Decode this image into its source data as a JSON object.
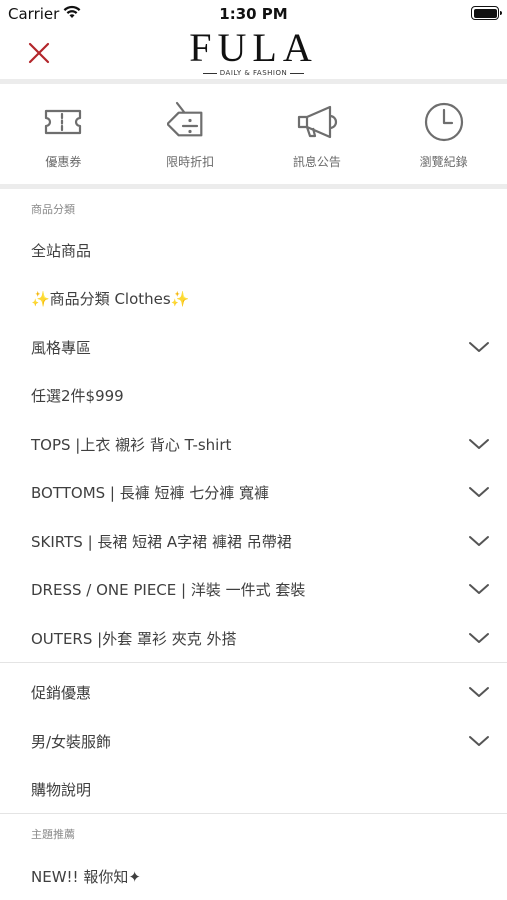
{
  "status_bar": {
    "carrier": "Carrier",
    "time": "1:30 PM"
  },
  "header": {
    "logo": "FULA",
    "logo_sub": "DAILY & FASHION"
  },
  "quick_links": [
    {
      "label": "優惠券",
      "icon": "coupon-ticket-icon"
    },
    {
      "label": "限時折扣",
      "icon": "discount-tag-icon"
    },
    {
      "label": "訊息公告",
      "icon": "megaphone-icon"
    },
    {
      "label": "瀏覽紀錄",
      "icon": "clock-icon"
    }
  ],
  "categories_section": {
    "title": "商品分類",
    "items": [
      {
        "label": "全站商品",
        "expandable": false
      },
      {
        "label": "✨商品分類 Clothes✨",
        "expandable": false
      },
      {
        "label": "風格專區",
        "expandable": true
      },
      {
        "label": "任選2件$999",
        "expandable": false
      },
      {
        "label": "TOPS  |上衣 襯衫 背心 T-shirt",
        "expandable": true
      },
      {
        "label": "BOTTOMS  | 長褲 短褲 七分褲 寬褲",
        "expandable": true
      },
      {
        "label": "SKIRTS   | 長裙 短裙 A字裙 褲裙 吊帶裙",
        "expandable": true
      },
      {
        "label": "DRESS / ONE PIECE  | 洋裝 一件式 套裝",
        "expandable": true
      },
      {
        "label": "OUTERS  |外套 罩衫 夾克 外搭",
        "expandable": true
      }
    ]
  },
  "info_section": {
    "items": [
      {
        "label": "促銷優惠",
        "expandable": true
      },
      {
        "label": "男/女裝服飾",
        "expandable": true
      },
      {
        "label": "購物說明",
        "expandable": false
      }
    ]
  },
  "theme_section": {
    "title": "主題推薦",
    "items": [
      {
        "label": "NEW!! 報你知✦",
        "expandable": false
      }
    ]
  },
  "colors": {
    "close_icon": "#b3262b",
    "icon_stroke": "#6e6e6e",
    "text": "#3f3f3f",
    "divider": "#ececec"
  }
}
